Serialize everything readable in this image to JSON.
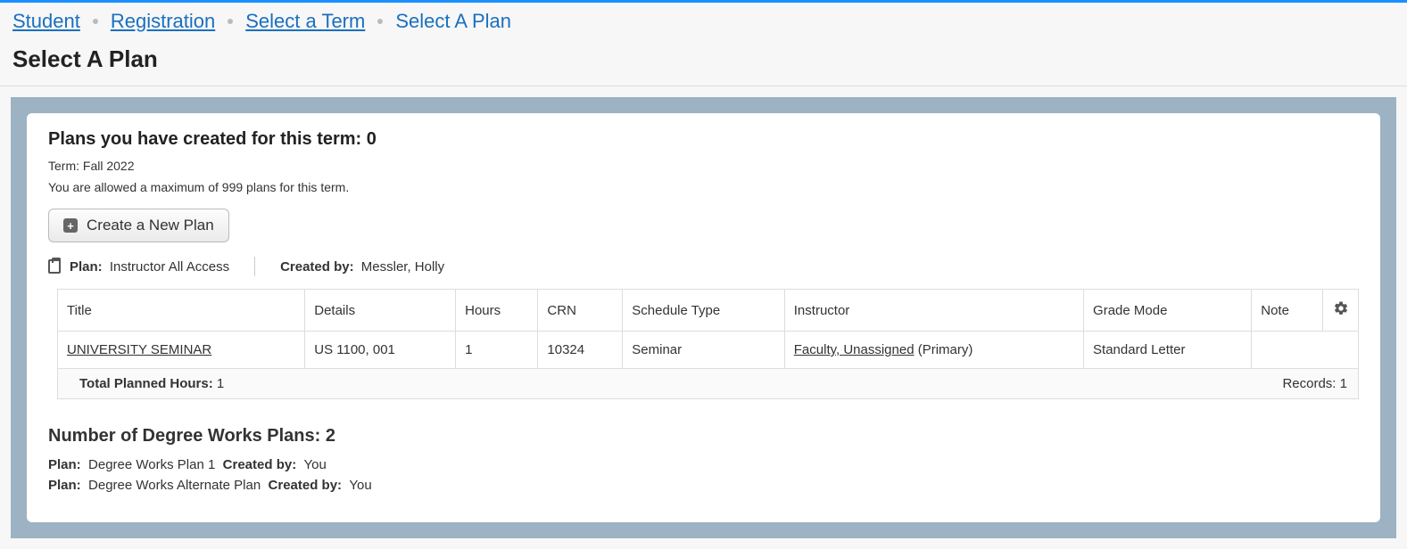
{
  "breadcrumb": {
    "items": [
      {
        "label": "Student",
        "link": true
      },
      {
        "label": "Registration",
        "link": true
      },
      {
        "label": "Select a Term",
        "link": true
      },
      {
        "label": "Select A Plan",
        "link": false
      }
    ]
  },
  "page_title": "Select A Plan",
  "plans_created": {
    "heading_prefix": "Plans you have created for this term: ",
    "count": "0",
    "term_label": "Term: ",
    "term_value": "Fall 2022",
    "max_text": "You are allowed a maximum of 999 plans for this term."
  },
  "create_button": {
    "label": "Create a New Plan"
  },
  "plan_meta": {
    "plan_label": "Plan:",
    "plan_value": "Instructor All Access",
    "created_by_label": "Created by:",
    "created_by_value": "Messler, Holly"
  },
  "table": {
    "headers": {
      "title": "Title",
      "details": "Details",
      "hours": "Hours",
      "crn": "CRN",
      "schedule_type": "Schedule Type",
      "instructor": "Instructor",
      "grade_mode": "Grade Mode",
      "note": "Note"
    },
    "rows": [
      {
        "title": "UNIVERSITY SEMINAR",
        "details": "US 1100, 001",
        "hours": "1",
        "crn": "10324",
        "schedule_type": "Seminar",
        "instructor_link": "Faculty, Unassigned",
        "instructor_suffix": " (Primary)",
        "grade_mode": "Standard Letter",
        "note": ""
      }
    ],
    "footer": {
      "total_label": "Total Planned Hours: ",
      "total_value": "1",
      "records_label": "Records: ",
      "records_value": "1"
    }
  },
  "degree_works": {
    "heading_prefix": "Number of Degree Works Plans: ",
    "count": "2",
    "plans": [
      {
        "plan_label": "Plan:",
        "plan_value": "Degree Works Plan 1",
        "cb_label": "Created by:",
        "cb_value": "You"
      },
      {
        "plan_label": "Plan:",
        "plan_value": "Degree Works Alternate Plan",
        "cb_label": "Created by:",
        "cb_value": "You"
      }
    ]
  }
}
